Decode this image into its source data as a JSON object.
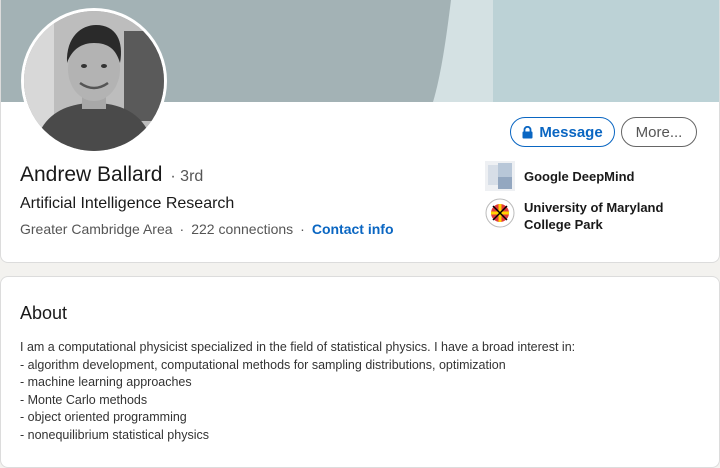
{
  "profile": {
    "name": "Andrew Ballard",
    "degree": "· 3rd",
    "headline": "Artificial Intelligence Research",
    "location": "Greater Cambridge Area",
    "separator": "·",
    "connections": "222 connections",
    "contact_info": "Contact info"
  },
  "actions": {
    "message_label": "Message",
    "more_label": "More..."
  },
  "organizations": [
    {
      "name": "Google DeepMind",
      "icon": "company-logo-placeholder-icon"
    },
    {
      "name": "University of Maryland College Park",
      "icon": "university-seal-icon"
    }
  ],
  "about": {
    "title": "About",
    "lines": [
      "I am a computational physicist specialized in the field of statistical physics. I have a broad interest in:",
      "- algorithm development, computational methods for sampling distributions, optimization",
      "- machine learning approaches",
      "- Monte Carlo methods",
      "- object oriented programming",
      "- nonequilibrium statistical physics"
    ]
  },
  "colors": {
    "accent": "#0a66c2",
    "banner_dark": "#a3b2b5",
    "banner_light": "#bcd2d6",
    "banner_mid": "#d4e1e3"
  }
}
